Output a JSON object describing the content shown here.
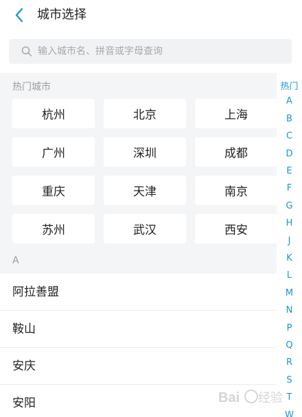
{
  "header": {
    "title": "城市选择",
    "back_icon": "chevron-left-icon",
    "accent": "#1a95d8"
  },
  "search": {
    "placeholder": "输入城市名、拼音或字母查询",
    "value": "",
    "icon": "search-icon"
  },
  "hot": {
    "title": "热门城市",
    "cities": [
      "杭州",
      "北京",
      "上海",
      "广州",
      "深圳",
      "成都",
      "重庆",
      "天津",
      "南京",
      "苏州",
      "武汉",
      "西安"
    ]
  },
  "section_a": {
    "title": "A",
    "cities": [
      "阿拉善盟",
      "鞍山",
      "安庆",
      "安阳"
    ]
  },
  "index_bar": {
    "items": [
      "热门",
      "A",
      "B",
      "C",
      "D",
      "E",
      "F",
      "G",
      "H",
      "J",
      "K",
      "L",
      "M",
      "N",
      "P",
      "Q",
      "R",
      "S",
      "T",
      "W"
    ]
  },
  "watermark": {
    "text": "Baidu 经验"
  }
}
